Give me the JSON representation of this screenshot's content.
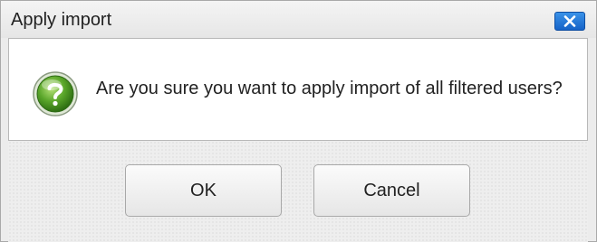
{
  "dialog": {
    "title": "Apply import",
    "close_icon": "close-icon",
    "message": "Are you sure you want to apply import of all filtered users?",
    "message_icon": "question-icon",
    "buttons": {
      "ok_label": "OK",
      "cancel_label": "Cancel"
    }
  },
  "colors": {
    "close_button": "#1f6fd4",
    "question_icon": "#5aa62a",
    "dialog_background": "#ececec"
  }
}
